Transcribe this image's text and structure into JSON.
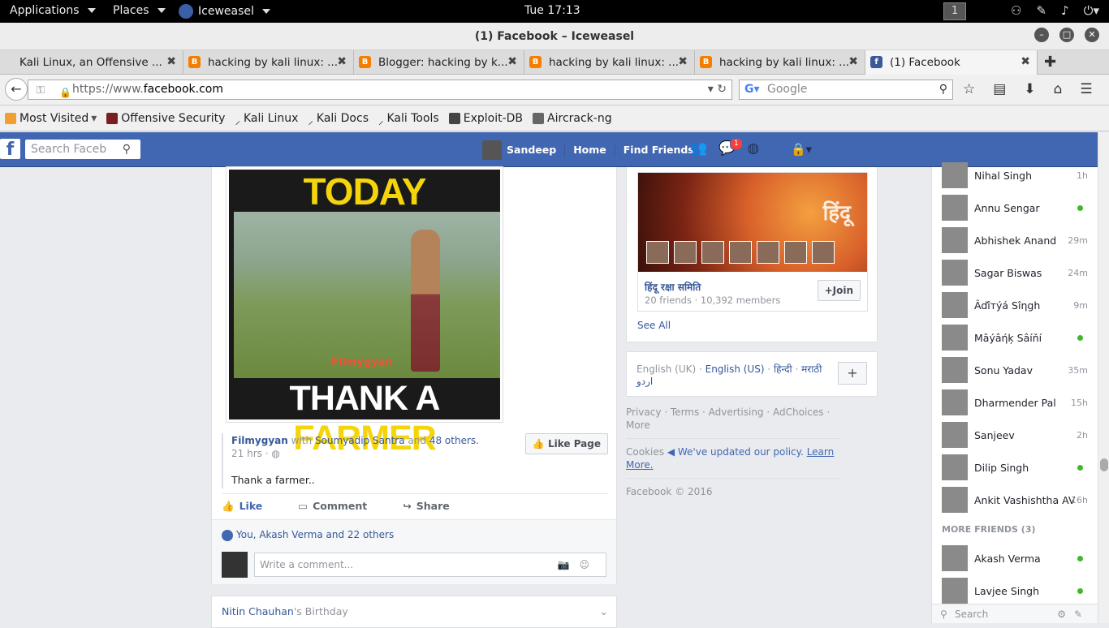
{
  "gnome": {
    "applications": "Applications",
    "places": "Places",
    "browser": "Iceweasel",
    "clock": "Tue 17:13",
    "workspace": "1"
  },
  "window": {
    "title": "(1) Facebook – Iceweasel"
  },
  "tabs": [
    {
      "label": "Kali Linux, an Offensive ..."
    },
    {
      "label": "hacking by kali linux: ..."
    },
    {
      "label": "Blogger: hacking by k..."
    },
    {
      "label": "hacking by kali linux: ..."
    },
    {
      "label": "hacking by kali linux: ..."
    },
    {
      "label": "(1) Facebook"
    }
  ],
  "navbar": {
    "url_prefix": "https://www.",
    "url_domain": "facebook.com",
    "search_placeholder": "Google"
  },
  "bookmarks": [
    {
      "label": "Most Visited"
    },
    {
      "label": "Offensive Security"
    },
    {
      "label": "Kali Linux"
    },
    {
      "label": "Kali Docs"
    },
    {
      "label": "Kali Tools"
    },
    {
      "label": "Exploit-DB"
    },
    {
      "label": "Aircrack-ng"
    }
  ],
  "fb": {
    "logo": "f",
    "search_placeholder": "Search Faceb",
    "user": "Sandeep",
    "home": "Home",
    "find_friends": "Find Friends",
    "notif_badge": "1"
  },
  "post": {
    "image_top": "TODAY",
    "image_brand": "Filmygyan",
    "image_bottom_a": "THANK A ",
    "image_bottom_b": "FARMER",
    "page": "Filmygyan",
    "with": "with",
    "tagged": "Soumyadip Santra",
    "and": "and",
    "others": "48 others.",
    "time": "21 hrs · ",
    "text": "Thank a farmer..",
    "like_page": "Like Page",
    "like": "Like",
    "comment": "Comment",
    "share": "Share",
    "likes": "You, Akash Verma and 22 others",
    "comment_placeholder": "Write a comment..."
  },
  "birthday": {
    "name": "Nitin Chauhan",
    "suffix": "'s Birthday"
  },
  "group": {
    "banner_text": "हिंदू",
    "name": "हिंदू रक्षा समिति",
    "sub": "20 friends · 10,392 members",
    "join": "Join",
    "see_all": "See All"
  },
  "languages": {
    "current": "English (UK) · ",
    "l1": "English (US)",
    "l2": "हिन्दी",
    "l3": "मराठी",
    "l4": "اردو"
  },
  "footer": {
    "links": "Privacy · Terms · Advertising · AdChoices · More",
    "cookies": "Cookies",
    "policy": "We've updated our policy.",
    "learn": "Learn More.",
    "copyright": "Facebook © 2016"
  },
  "chat": {
    "friends": [
      {
        "name": "Nihal Singh",
        "status": "1h"
      },
      {
        "name": "Annu Sengar",
        "status": ""
      },
      {
        "name": "Abhishek Anand",
        "status": "29m"
      },
      {
        "name": "Sagar Biswas",
        "status": "24m"
      },
      {
        "name": "Âďîтýá Sîηgh",
        "status": "9m"
      },
      {
        "name": "Mâýâήķ Sâíňí",
        "status": ""
      },
      {
        "name": "Sonu Yadav",
        "status": "35m"
      },
      {
        "name": "Dharmender Pal",
        "status": "15h"
      },
      {
        "name": "Sanjeev",
        "status": "2h"
      },
      {
        "name": "Dilip Singh",
        "status": ""
      },
      {
        "name": "Ankit Vashishtha AV",
        "status": "16h"
      }
    ],
    "more_header": "MORE FRIENDS (3)",
    "more": [
      {
        "name": "Akash Verma",
        "status": ""
      },
      {
        "name": "Lavjee Singh",
        "status": ""
      }
    ],
    "search_placeholder": "Search"
  }
}
